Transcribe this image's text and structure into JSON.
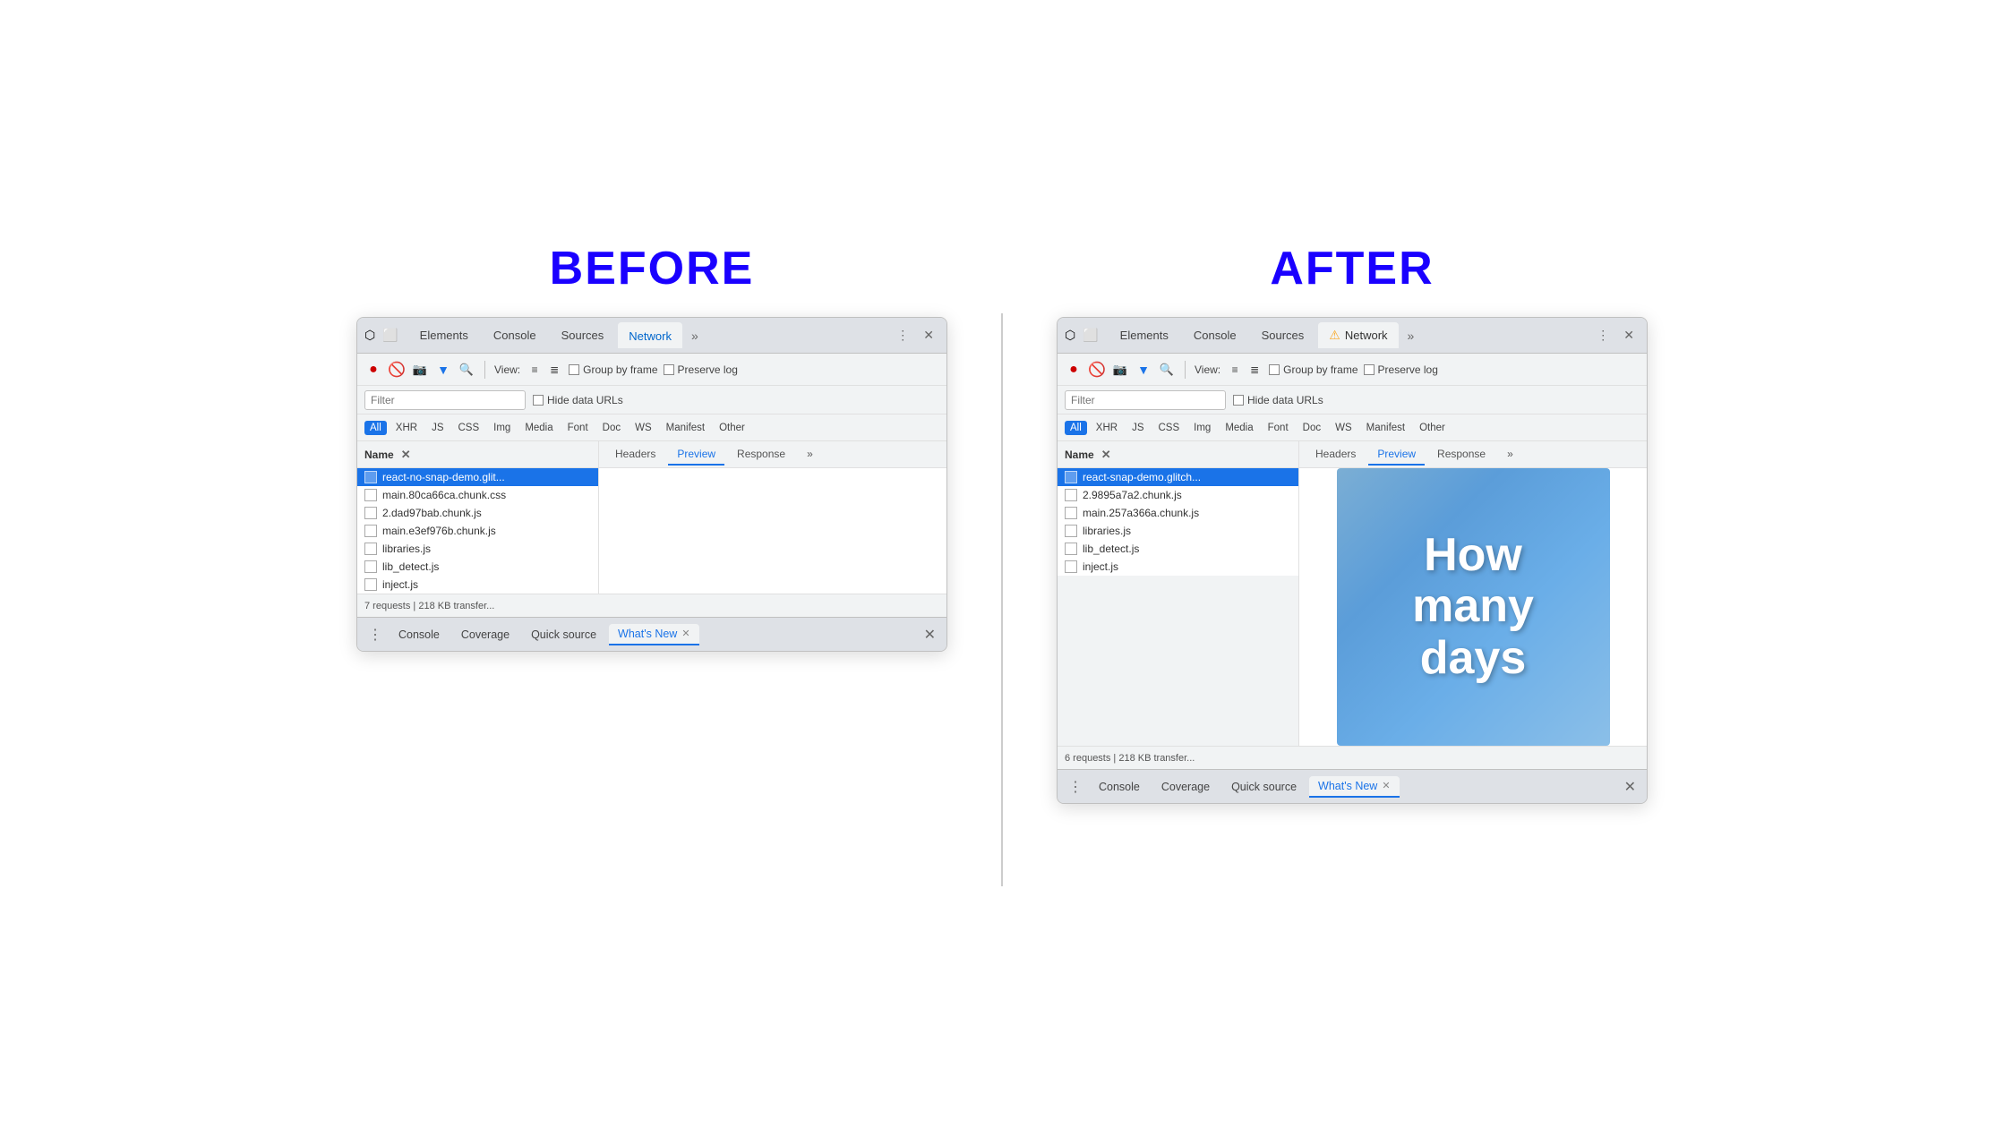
{
  "before_label": "BEFORE",
  "after_label": "AFTER",
  "before_panel": {
    "tabs": [
      "Elements",
      "Console",
      "Sources",
      "Network",
      "»"
    ],
    "active_tab": "Network",
    "toolbar": {
      "view_label": "View:",
      "group_by_frame_label": "Group by frame",
      "preserve_log_label": "Preserve log"
    },
    "filter_placeholder": "Filter",
    "hide_data_urls_label": "Hide data URLs",
    "resource_types": [
      "All",
      "XHR",
      "JS",
      "CSS",
      "Img",
      "Media",
      "Font",
      "Doc",
      "WS",
      "Manifest",
      "Other"
    ],
    "active_resource": "All",
    "name_header": "Name",
    "detail_tabs": [
      "Headers",
      "Preview",
      "Response",
      "»"
    ],
    "active_detail_tab": "Preview",
    "files": [
      {
        "name": "react-no-snap-demo.glit...",
        "selected": true
      },
      {
        "name": "main.80ca66ca.chunk.css",
        "selected": false
      },
      {
        "name": "2.dad97bab.chunk.js",
        "selected": false
      },
      {
        "name": "main.e3ef976b.chunk.js",
        "selected": false
      },
      {
        "name": "libraries.js",
        "selected": false
      },
      {
        "name": "lib_detect.js",
        "selected": false
      },
      {
        "name": "inject.js",
        "selected": false
      }
    ],
    "status": "7 requests | 218 KB transfer...",
    "drawer_tabs": [
      "Console",
      "Coverage",
      "Quick source",
      "What's New"
    ],
    "active_drawer_tab": "What's New",
    "preview_type": "blank"
  },
  "after_panel": {
    "tabs": [
      "Elements",
      "Console",
      "Sources",
      "Network",
      "»"
    ],
    "active_tab": "Network",
    "toolbar": {
      "view_label": "View:",
      "group_by_frame_label": "Group by frame",
      "preserve_log_label": "Preserve log"
    },
    "filter_placeholder": "Filter",
    "hide_data_urls_label": "Hide data URLs",
    "resource_types": [
      "All",
      "XHR",
      "JS",
      "CSS",
      "Img",
      "Media",
      "Font",
      "Doc",
      "WS",
      "Manifest",
      "Other"
    ],
    "active_resource": "All",
    "name_header": "Name",
    "detail_tabs": [
      "Headers",
      "Preview",
      "Response",
      "»"
    ],
    "active_detail_tab": "Preview",
    "files": [
      {
        "name": "react-snap-demo.glitch...",
        "selected": true
      },
      {
        "name": "2.9895a7a2.chunk.js",
        "selected": false
      },
      {
        "name": "main.257a366a.chunk.js",
        "selected": false
      },
      {
        "name": "libraries.js",
        "selected": false
      },
      {
        "name": "lib_detect.js",
        "selected": false
      },
      {
        "name": "inject.js",
        "selected": false
      }
    ],
    "status": "6 requests | 218 KB transfer...",
    "drawer_tabs": [
      "Console",
      "Coverage",
      "Quick source",
      "What's New"
    ],
    "active_drawer_tab": "What's New",
    "preview_type": "image",
    "preview_text": [
      "How",
      "many",
      "days"
    ]
  },
  "icons": {
    "record": "●",
    "no_entry": "🚫",
    "camera": "📷",
    "filter": "⏺",
    "search": "🔍",
    "cursor": "⬡",
    "mobile": "⬡",
    "more": "⋮",
    "close": "✕",
    "warning": "⚠",
    "list_dense": "≡",
    "list_normal": "≣",
    "menu_dots": "⋮"
  }
}
